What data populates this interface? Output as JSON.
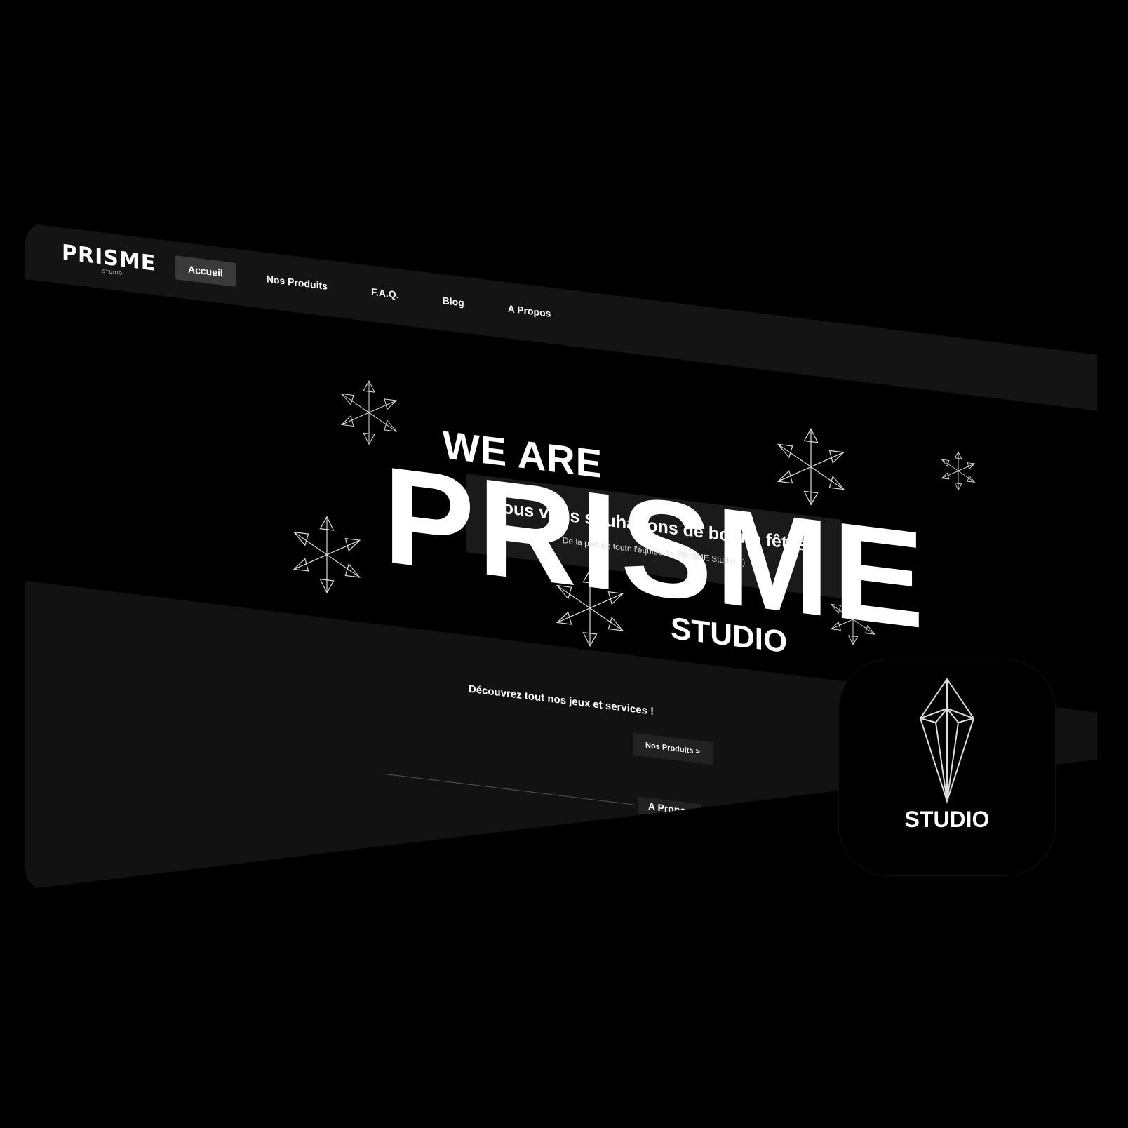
{
  "brand": {
    "logo": "PRISME",
    "logo_sub": "STUDIO"
  },
  "nav": {
    "items": [
      {
        "label": "Accueil",
        "active": true
      },
      {
        "label": "Nos Produits",
        "active": false
      },
      {
        "label": "F.A.Q.",
        "active": false
      },
      {
        "label": "Blog",
        "active": false
      },
      {
        "label": "A Propos",
        "active": false
      }
    ]
  },
  "hero": {
    "we_are": "WE ARE",
    "title": "PRISME",
    "studio": "STUDIO",
    "notice_title": "Nous vous souhaitons de bonne fêtes !",
    "notice_sub": "De la part de toute l'équipe de PRISME Studio. ;)"
  },
  "section": {
    "discover": "Découvrez tout nos jeux et services !",
    "cta": "Nos Produits >",
    "about_heading": "A Propos"
  },
  "app_icon": {
    "label": "STUDIO",
    "icon": "crystal-prism-icon"
  },
  "colors": {
    "background": "#000000",
    "navbar": "#141414",
    "section": "#121212",
    "active_nav": "#3a3a3a"
  }
}
